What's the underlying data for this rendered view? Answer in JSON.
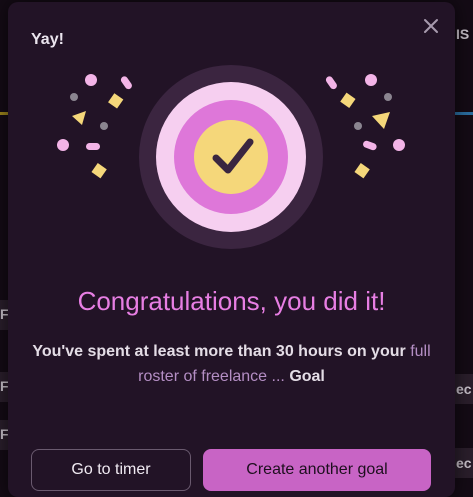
{
  "background_text": {
    "right_top": "IS",
    "left_row_1": "F",
    "left_row_2": "F",
    "left_row_3": "F",
    "right_row_1": "ec",
    "right_row_2": "ec"
  },
  "modal": {
    "title": "Yay!",
    "close_icon": "close-icon",
    "illustration_icon": "checkmark-target-icon",
    "headline": "Congratulations, you did it!",
    "body_prefix": "You've spent at least more than 30 hours on your",
    "goal_name": "full roster of freelance ...",
    "body_suffix": "Goal",
    "secondary_button": "Go to timer",
    "primary_button": "Create another goal"
  },
  "colors": {
    "modal_bg": "#221326",
    "accent_pink": "#e77ee3",
    "primary_button_bg": "#c864c5",
    "confetti_pink": "#f3b4e7",
    "confetti_yellow": "#f5d77a",
    "confetti_gray": "#8b8590"
  }
}
